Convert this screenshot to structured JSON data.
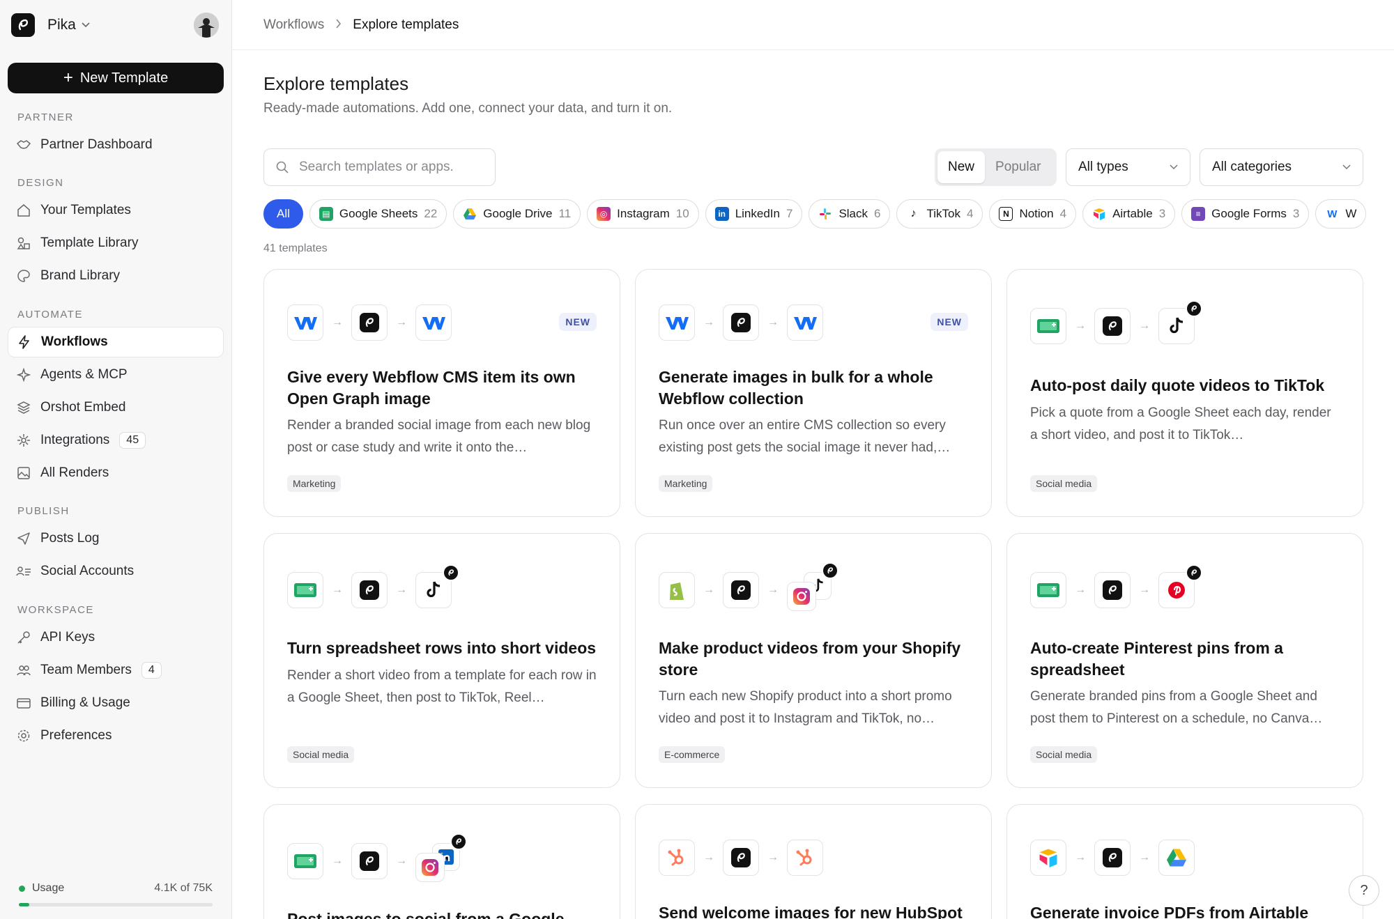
{
  "workspace": {
    "name": "Pika"
  },
  "sidebar": {
    "new_template": "New Template",
    "sections": {
      "partner": "PARTNER",
      "design": "DESIGN",
      "automate": "AUTOMATE",
      "publish": "PUBLISH",
      "workspace": "WORKSPACE"
    },
    "items": {
      "partner_dashboard": "Partner Dashboard",
      "your_templates": "Your Templates",
      "template_library": "Template Library",
      "brand_library": "Brand Library",
      "workflows": "Workflows",
      "agents_mcp": "Agents & MCP",
      "orshot_embed": "Orshot Embed",
      "integrations": "Integrations",
      "integrations_count": "45",
      "all_renders": "All Renders",
      "posts_log": "Posts Log",
      "social_accounts": "Social Accounts",
      "api_keys": "API Keys",
      "team_members": "Team Members",
      "team_members_count": "4",
      "billing": "Billing & Usage",
      "preferences": "Preferences"
    },
    "usage": {
      "label": "Usage",
      "value": "4.1K of 75K",
      "fraction": 0.055
    }
  },
  "breadcrumb": {
    "parent": "Workflows",
    "current": "Explore templates"
  },
  "page": {
    "title": "Explore templates",
    "subtitle": "Ready-made automations. Add one, connect your data, and turn it on."
  },
  "filters": {
    "search_placeholder": "Search templates or apps.",
    "sort_new": "New",
    "sort_popular": "Popular",
    "types": "All types",
    "categories": "All categories",
    "chips": [
      {
        "label": "All"
      },
      {
        "label": "Google Sheets",
        "count": "22"
      },
      {
        "label": "Google Drive",
        "count": "11"
      },
      {
        "label": "Instagram",
        "count": "10"
      },
      {
        "label": "LinkedIn",
        "count": "7"
      },
      {
        "label": "Slack",
        "count": "6"
      },
      {
        "label": "TikTok",
        "count": "4"
      },
      {
        "label": "Notion",
        "count": "4"
      },
      {
        "label": "Airtable",
        "count": "3"
      },
      {
        "label": "Google Forms",
        "count": "3"
      },
      {
        "label": "W"
      }
    ],
    "result_count": "41 templates"
  },
  "cards": [
    {
      "title": "Give every Webflow CMS item its own Open Graph image",
      "desc": "Render a branded social image from each new blog post or case study and write it onto the…",
      "tag": "Marketing",
      "badge": "NEW"
    },
    {
      "title": "Generate images in bulk for a whole Webflow collection",
      "desc": "Run once over an entire CMS collection so every existing post gets the social image it never had,…",
      "tag": "Marketing",
      "badge": "NEW"
    },
    {
      "title": "Auto-post daily quote videos to TikTok",
      "desc": "Pick a quote from a Google Sheet each day, render a short video, and post it to TikTok…",
      "tag": "Social media"
    },
    {
      "title": "Turn spreadsheet rows into short videos",
      "desc": "Render a short video from a template for each row in a Google Sheet, then post to TikTok, Reel…",
      "tag": "Social media"
    },
    {
      "title": "Make product videos from your Shopify store",
      "desc": "Turn each new Shopify product into a short promo video and post it to Instagram and TikTok, no…",
      "tag": "E-commerce"
    },
    {
      "title": "Auto-create Pinterest pins from a spreadsheet",
      "desc": "Generate branded pins from a Google Sheet and post them to Pinterest on a schedule, no Canva…",
      "tag": "Social media"
    },
    {
      "title": "Post images to social from a Google"
    },
    {
      "title": "Send welcome images for new HubSpot"
    },
    {
      "title": "Generate invoice PDFs from Airtable"
    }
  ],
  "colors": {
    "accent": "#2f5bea",
    "usage": "#22a559"
  }
}
